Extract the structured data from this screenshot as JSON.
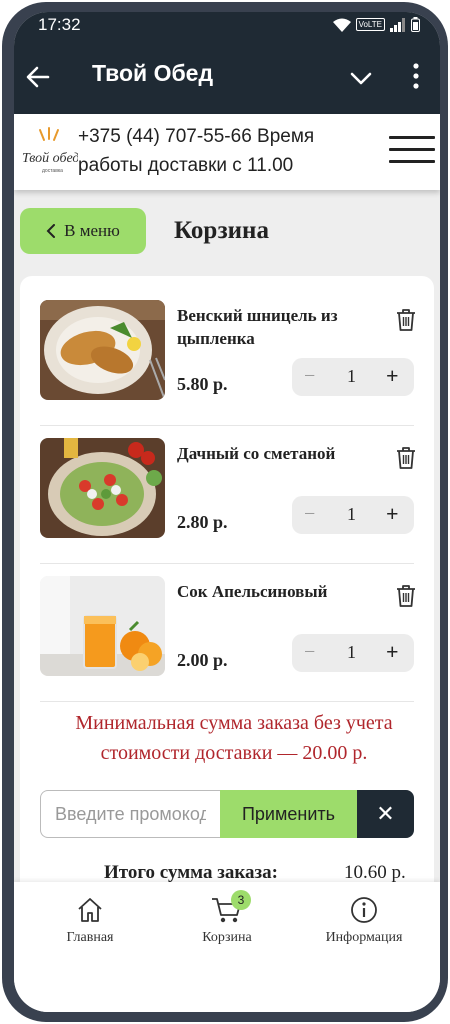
{
  "status_bar": {
    "time": "17:32",
    "network": "VoLTE"
  },
  "app_bar": {
    "title": "Твой Обед"
  },
  "site_header": {
    "contact": "+375 (44) 707-55-66 Время работы доставки с 11.00",
    "logo_text": "Твой обед",
    "logo_sub": "доставка"
  },
  "page": {
    "back_to_menu": "В меню",
    "title": "Корзина"
  },
  "cart": {
    "items": [
      {
        "name": "Венский шницель из цыпленка",
        "price": "5.80 р.",
        "qty": "1"
      },
      {
        "name": "Дачный со сметаной",
        "price": "2.80 р.",
        "qty": "1"
      },
      {
        "name": "Сок Апельсиновый",
        "price": "2.00 р.",
        "qty": "1"
      }
    ],
    "minus": "−",
    "plus": "+",
    "min_sum_notice": "Минимальная сумма заказа без учета стоимости доставки — 20.00 р.",
    "promo_placeholder": "Введите промокод",
    "apply_label": "Применить",
    "clear_label": "✕",
    "total_label": "Итого сумма заказа:",
    "total_value": "10.60 р."
  },
  "bottom_nav": {
    "home": "Главная",
    "cart": "Корзина",
    "cart_badge": "3",
    "info": "Информация"
  },
  "colors": {
    "accent": "#9ddc6b",
    "dark": "#1f2a34",
    "warning": "#b0262c"
  }
}
